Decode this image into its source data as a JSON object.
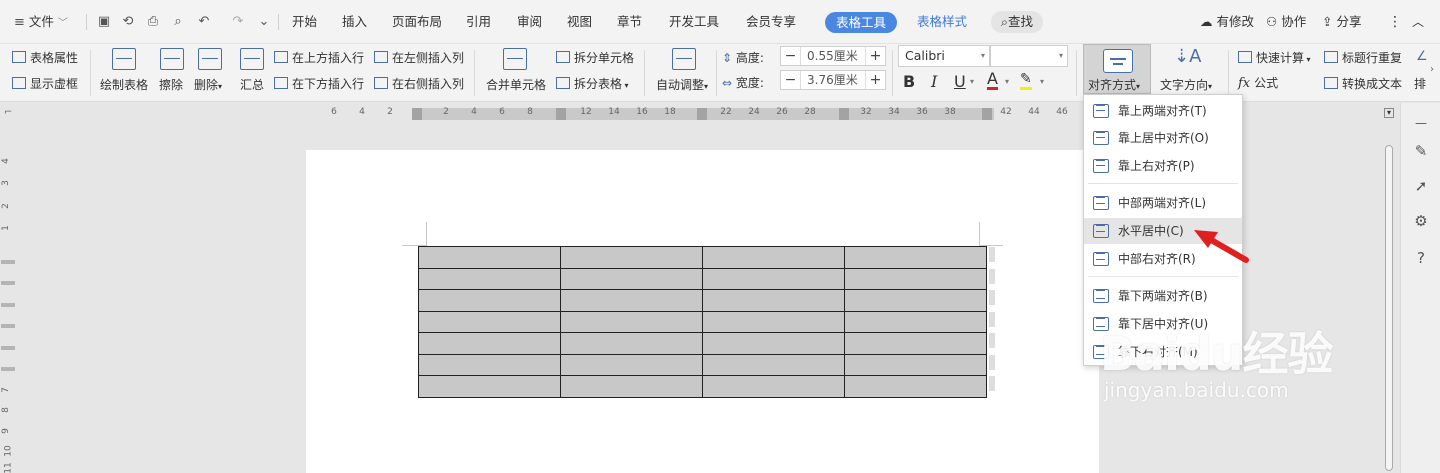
{
  "menubar": {
    "file": "文件",
    "tabs": [
      "开始",
      "插入",
      "页面布局",
      "引用",
      "审阅",
      "视图",
      "章节",
      "开发工具",
      "会员专享"
    ],
    "active_tab": "表格工具",
    "table_style_tab": "表格样式",
    "search": "查找",
    "modified": "有修改",
    "collaborate": "协作",
    "share": "分享"
  },
  "ribbon": {
    "table_props": "表格属性",
    "show_grid": "显示虚框",
    "draw_table": "绘制表格",
    "erase": "擦除",
    "delete": "删除",
    "summary": "汇总",
    "insert_above": "在上方插入行",
    "insert_below": "在下方插入行",
    "insert_left": "在左侧插入列",
    "insert_right": "在右侧插入列",
    "merge_cells": "合并单元格",
    "split_cells": "拆分单元格",
    "split_table": "拆分表格",
    "auto_fit": "自动调整",
    "height_label": "高度:",
    "height_value": "0.55厘米",
    "width_label": "宽度:",
    "width_value": "3.76厘米",
    "font_name": "Calibri",
    "bold": "B",
    "italic": "I",
    "underline": "U",
    "font_color": "A",
    "align": "对齐方式",
    "text_direction": "文字方向",
    "quick_calc": "快速计算",
    "title_repeat": "标题行重复",
    "formula": "公式",
    "convert_text": "转换成文本",
    "more": "排"
  },
  "ruler": {
    "ticks": [
      "6",
      "4",
      "2",
      "2",
      "4",
      "6",
      "8",
      "12",
      "14",
      "16",
      "18",
      "22",
      "24",
      "26",
      "28",
      "32",
      "34",
      "36",
      "38",
      "42",
      "44",
      "46"
    ],
    "vticks": [
      "4",
      "3",
      "2",
      "1",
      "7",
      "8",
      "9",
      "10",
      "11"
    ]
  },
  "table": {
    "rows": 7,
    "cols": 4
  },
  "dropdown": {
    "items": [
      "靠上两端对齐(T)",
      "靠上居中对齐(O)",
      "靠上右对齐(P)",
      "中部两端对齐(L)",
      "水平居中(C)",
      "中部右对齐(R)",
      "靠下两端对齐(B)",
      "靠下居中对齐(U)",
      "靠下右对齐(M)"
    ],
    "highlighted_index": 4
  },
  "watermark": {
    "brand_text": "Baidu经验",
    "url": "jingyan.baidu.com"
  },
  "colors": {
    "accent": "#4a87e0",
    "arrow": "#e02020"
  },
  "icons": [
    "save-icon",
    "undo-icon",
    "redo-icon",
    "print-icon",
    "preview-icon",
    "cloud-icon",
    "user-icon",
    "share-icon",
    "more-icon",
    "collapse-icon",
    "pen-icon",
    "cursor-icon",
    "settings-icon",
    "help-icon"
  ]
}
